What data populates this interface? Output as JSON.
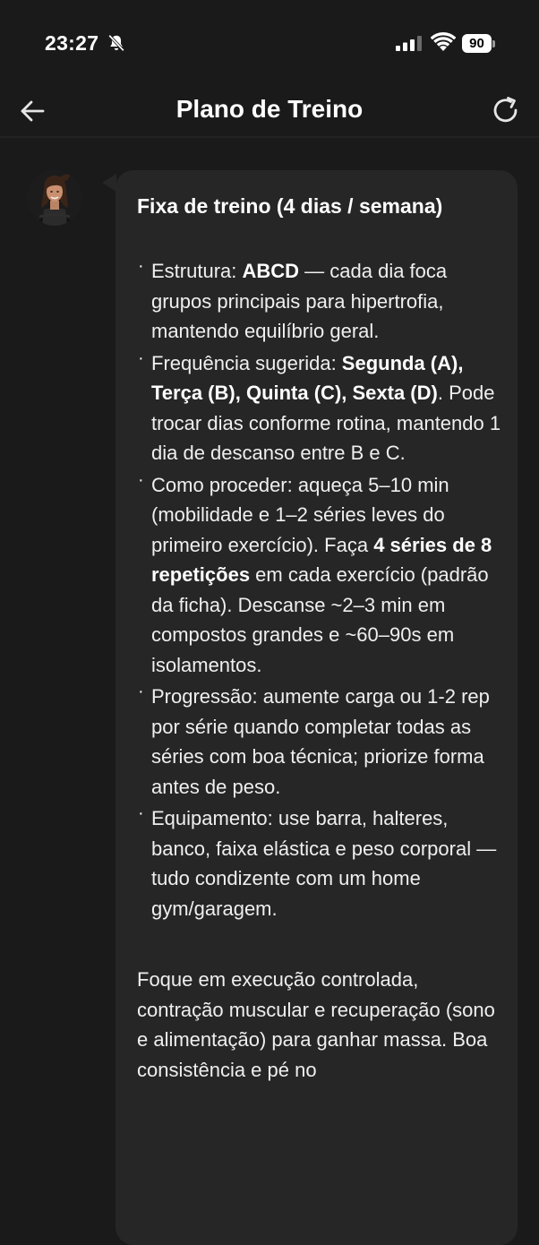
{
  "status_bar": {
    "time": "23:27",
    "battery_level": "90",
    "icons": [
      "bell-slash-icon",
      "signal-icon",
      "wifi-icon",
      "battery-icon"
    ]
  },
  "header": {
    "title": "Plano de Treino",
    "back_icon": "arrow-left-icon",
    "refresh_icon": "refresh-icon"
  },
  "message": {
    "title": "Fixa de treino (4 dias / semana)",
    "bullet_glyph": "·",
    "items": [
      {
        "prefix": "Estrutura: ",
        "bold1": "ABCD",
        "mid": " — cada dia foca grupos principais para hipertrofia, mantendo equilíbrio geral.",
        "bold2": "",
        "suffix": ""
      },
      {
        "prefix": "Frequência sugerida: ",
        "bold1": "Segunda (A), Terça (B), Quinta (C), Sexta (D)",
        "mid": ". Pode trocar dias conforme rotina, mantendo 1 dia de descanso entre B e C.",
        "bold2": "",
        "suffix": ""
      },
      {
        "prefix": "Como proceder: aqueça 5–10 min (mobilidade e 1–2 séries leves do primeiro exercício). Faça ",
        "bold1": "4 séries de 8 repetições",
        "mid": " em cada exercício (padrão da ficha). Descanse ~2–3 min em compostos grandes e ~60–90s em isolamentos.",
        "bold2": "",
        "suffix": ""
      },
      {
        "prefix": "Progressão: aumente carga ou 1-2 rep por série quando completar todas as séries com boa técnica; priorize forma antes de peso.",
        "bold1": "",
        "mid": "",
        "bold2": "",
        "suffix": ""
      },
      {
        "prefix": "Equipamento: use barra, halteres, banco, faixa elástica e peso corporal — tudo condizente com um home gym/garagem.",
        "bold1": "",
        "mid": "",
        "bold2": "",
        "suffix": ""
      }
    ],
    "closing": "Foque em execução controlada, contração muscular e recuperação (sono e alimentação) para ganhar massa. Boa consistência e pé no"
  },
  "colors": {
    "background": "#1a1a1a",
    "bubble": "#262626",
    "text": "#efefef",
    "title": "#ffffff"
  }
}
